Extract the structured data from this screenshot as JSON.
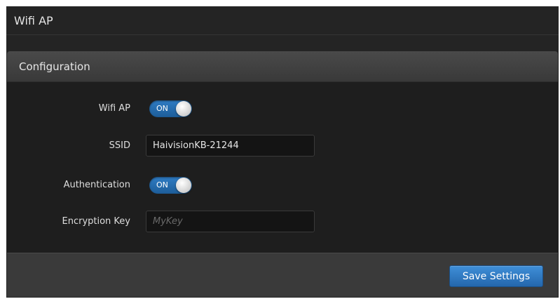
{
  "window": {
    "title": "Wifi AP"
  },
  "panel": {
    "title": "Configuration"
  },
  "form": {
    "wifi_ap": {
      "label": "Wifi AP",
      "state": "ON"
    },
    "ssid": {
      "label": "SSID",
      "value": "HaivisionKB-21244"
    },
    "authentication": {
      "label": "Authentication",
      "state": "ON"
    },
    "encryption_key": {
      "label": "Encryption Key",
      "value": "",
      "placeholder": "MyKey"
    }
  },
  "footer": {
    "save_label": "Save Settings"
  },
  "colors": {
    "accent": "#2f7cc4",
    "background": "#242424",
    "panel_header": "#424242",
    "footer": "#3a3a3a"
  }
}
